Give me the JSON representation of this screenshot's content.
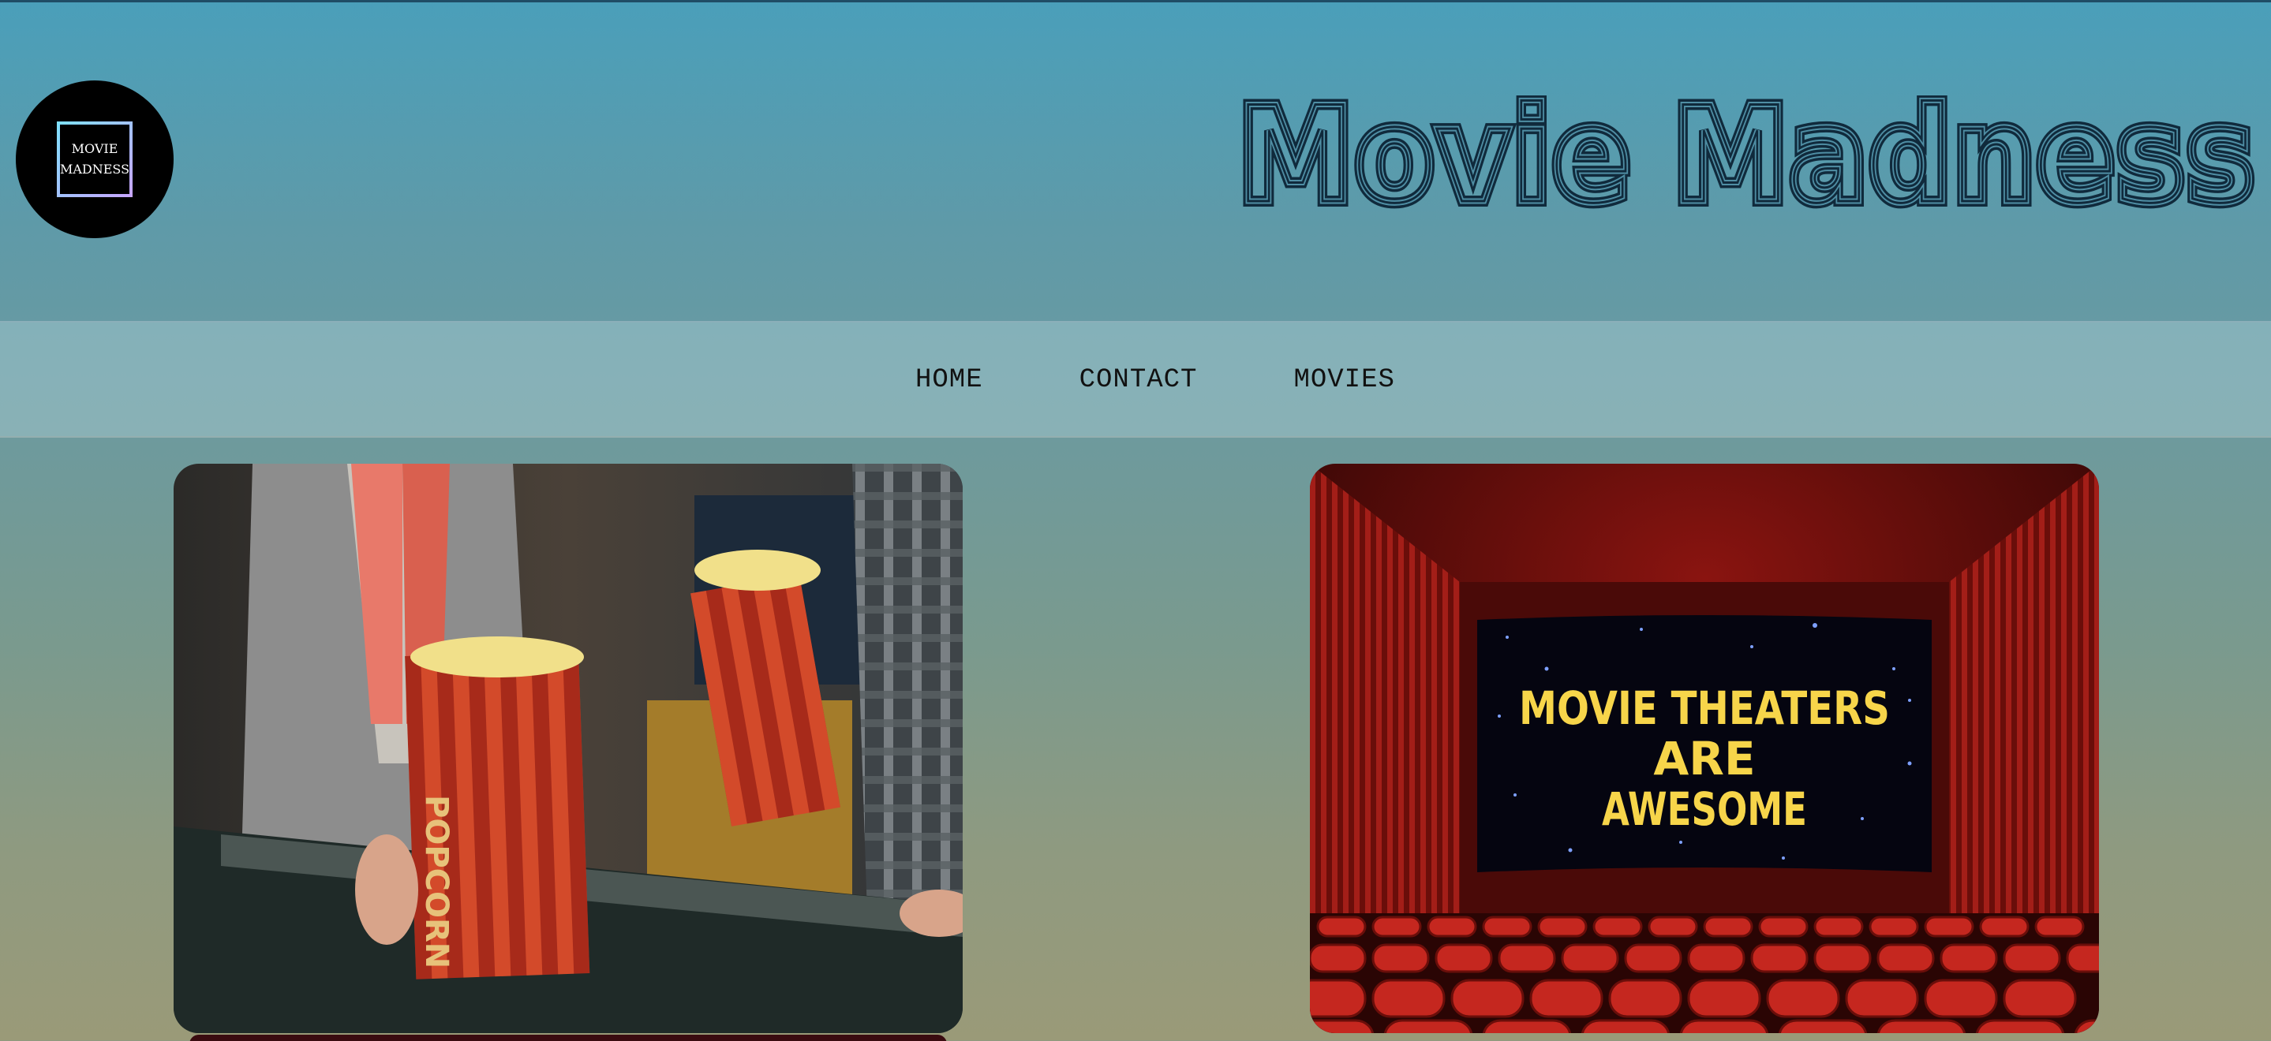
{
  "header": {
    "logo": {
      "line1": "MOVIE",
      "line2": "MADNESS"
    },
    "title": "Movie Madness"
  },
  "nav": {
    "items": [
      {
        "label": "HOME"
      },
      {
        "label": "CONTACT"
      },
      {
        "label": "MOVIES"
      }
    ]
  },
  "gallery": {
    "left": {
      "subject": "popcorn bags at concession counter",
      "printed_text": "POPCORN"
    },
    "right": {
      "subject": "movie theater screen with red seats and curtains",
      "screen_text": [
        "MOVIE THEATERS",
        "ARE",
        "AWESOME"
      ]
    }
  },
  "colors": {
    "header_top": "#4a9fba",
    "title_stroke": "#102a3c",
    "nav_text": "#111111",
    "theater_red": "#b0221c",
    "screen_text": "#f7d54a"
  }
}
